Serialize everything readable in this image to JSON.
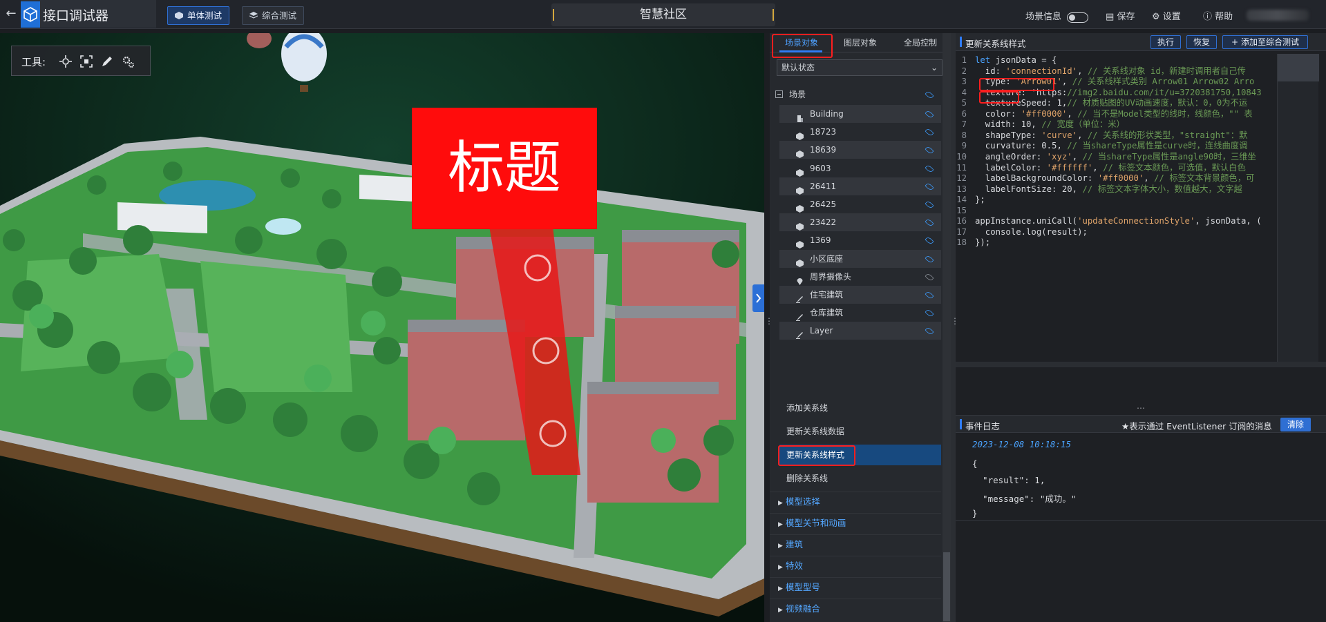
{
  "app": {
    "title": "接口调试器"
  },
  "tabs": {
    "single": "单体测试",
    "combined": "综合测试"
  },
  "scene_name": "智慧社区",
  "top_right": {
    "scene_info": "场景信息",
    "save": "保存",
    "settings": "设置",
    "help": "帮助"
  },
  "viewport": {
    "tools_label": "工具:",
    "overlay_title": "标题"
  },
  "panel": {
    "tabs": [
      "场景对象",
      "图层对象",
      "全局控制"
    ],
    "state_select": "默认状态",
    "root": "场景",
    "tree": [
      {
        "label": "Building",
        "icon": "building-icon",
        "visible": true
      },
      {
        "label": "18723",
        "icon": "cube-icon",
        "visible": true
      },
      {
        "label": "18639",
        "icon": "cube-icon",
        "visible": true
      },
      {
        "label": "9603",
        "icon": "cube-icon",
        "visible": true
      },
      {
        "label": "26411",
        "icon": "cube-icon",
        "visible": true
      },
      {
        "label": "26425",
        "icon": "cube-icon",
        "visible": true
      },
      {
        "label": "23422",
        "icon": "cube-icon",
        "visible": true
      },
      {
        "label": "1369",
        "icon": "cube-icon",
        "visible": true
      },
      {
        "label": "小区底座",
        "icon": "cube-icon",
        "visible": true
      },
      {
        "label": "周界摄像头",
        "icon": "pin-icon",
        "visible": false
      },
      {
        "label": "住宅建筑",
        "icon": "brush-icon",
        "visible": true
      },
      {
        "label": "仓库建筑",
        "icon": "brush-icon",
        "visible": true
      },
      {
        "label": "Layer",
        "icon": "brush-icon",
        "visible": true
      }
    ],
    "functions": [
      "添加关系线",
      "更新关系线数据",
      "更新关系线样式",
      "删除关系线"
    ],
    "groups": [
      "模型选择",
      "模型关节和动画",
      "建筑",
      "特效",
      "模型型号",
      "视频融合"
    ]
  },
  "code": {
    "title": "更新关系线样式",
    "buttons": {
      "run": "执行",
      "reset": "恢复",
      "add": "添加至综合测试"
    },
    "lines": [
      "let jsonData = {",
      "  id: 'connectionId', // 关系线对象 id，新建时调用者自己传",
      "  type: 'Arrow01', // 关系线样式类别 Arrow01 Arrow02 Arro",
      "  texture: 'https://img2.baidu.com/it/u=3720381750,10843",
      "  textureSpeed: 1,// 材质贴图的UV动画速度，默认：0，0为不运",
      "  color: '#ff0000', // 当不是Model类型的线时，线颜色，\"\" 表",
      "  width: 10, // 宽度（单位：米）",
      "  shapeType: 'curve', // 关系线的形状类型，\"straight\"：默",
      "  curvature: 0.5, // 当shareType属性是curve时，连线曲度调",
      "  angleOrder: 'xyz', // 当shareType属性是angle90时，三维坐",
      "  labelColor: '#ffffff', // 标签文本颜色，可选值，默认白色",
      "  labelBackgroundColor: '#ff0000', // 标签文本背景颜色，可",
      "  labelFontSize: 20, // 标签文本字体大小，数值越大，文字越",
      "};",
      "",
      "appInstance.uniCall('updateConnectionStyle', jsonData, (",
      "  console.log(result);",
      "});"
    ]
  },
  "log": {
    "title": "事件日志",
    "note": "★表示通过 EventListener 订阅的消息",
    "clear": "清除",
    "time": "2023-12-08 10:18:15",
    "body": [
      "{",
      "  \"result\": 1,",
      "  \"message\": \"成功。\"",
      "}"
    ]
  },
  "colors": {
    "accent": "#2f7cf6",
    "highlight_red": "#ff1e1e",
    "overlay_red": "#ff0c0c"
  }
}
